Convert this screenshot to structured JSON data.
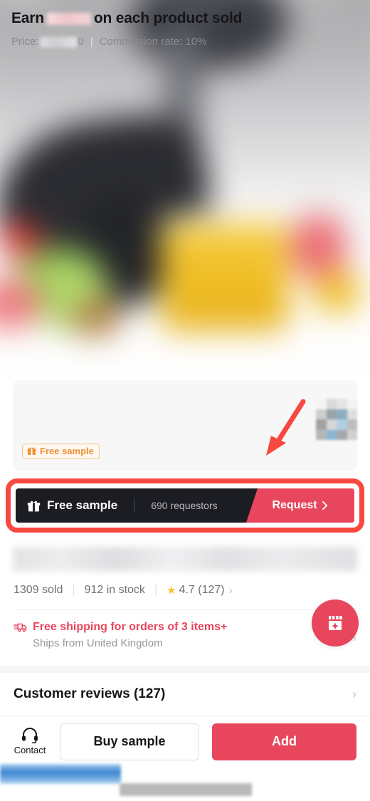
{
  "hero": {
    "alt": "blurred-product-photo-juicer-with-juice-glass-fruits-and-greens"
  },
  "earn_card": {
    "title_prefix": "Earn",
    "title_amount_redacted": "",
    "title_suffix": "on each product sold",
    "price_label": "Price:",
    "price_value_redacted": "0",
    "separator": "|",
    "commission_label": "Commission rate: 10%",
    "tag_label": "Free sample",
    "tag_icon": "gift-icon",
    "mosaic_label": "redacted-badge"
  },
  "free_sample_banner": {
    "icon": "gift-icon",
    "label": "Free sample",
    "requestors": "690 requestors",
    "cta": "Request",
    "cta_icon": "chevron-right-icon",
    "highlight_color": "#f8483f",
    "banner_bg": "#1c1d23",
    "cta_bg": "#e8465c"
  },
  "product": {
    "title_redacted": "",
    "sold": "1309 sold",
    "stock": "912 in stock",
    "rating_star_icon": "star-icon",
    "rating": "4.7 (127)",
    "rating_chevron": "›"
  },
  "shipping": {
    "icon": "delivery-truck-icon",
    "headline": "Free shipping for orders of 3 items+",
    "subline": "Ships from United Kingdom",
    "chevron": "›",
    "accent_color": "#e8465c"
  },
  "floating_button": {
    "icon": "shop-storefront-sparkle-icon",
    "color": "#e8465c"
  },
  "reviews": {
    "title": "Customer reviews (127)",
    "chevron": "›"
  },
  "bottom_bar": {
    "contact_icon": "headset-icon",
    "contact_label": "Contact",
    "buy_sample_label": "Buy sample",
    "add_label": "Add",
    "add_color": "#e8465c"
  }
}
